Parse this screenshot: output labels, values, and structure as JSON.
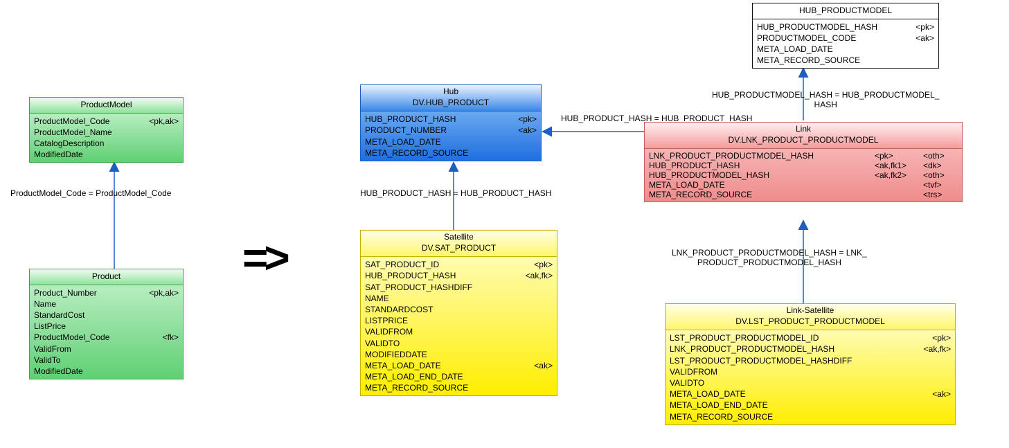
{
  "arrow": "=>",
  "rel": {
    "pm_prod": "ProductModel_Code = ProductModel_Code",
    "hub_sat": "HUB_PRODUCT_HASH = HUB_PRODUCT_HASH",
    "hub_link": "HUB_PRODUCT_HASH = HUB_PRODUCT_HASH",
    "hubpm_link_l1": "HUB_PRODUCTMODEL_HASH = HUB_PRODUCTMODEL_",
    "hubpm_link_l2": "HASH",
    "link_lst_l1": "LNK_PRODUCT_PRODUCTMODEL_HASH = LNK_",
    "link_lst_l2": "PRODUCT_PRODUCTMODEL_HASH"
  },
  "entities": {
    "productmodel": {
      "title": "ProductModel",
      "rows": [
        {
          "name": "ProductModel_Code",
          "key": "<pk,ak>"
        },
        {
          "name": "ProductModel_Name",
          "key": ""
        },
        {
          "name": "CatalogDescription",
          "key": ""
        },
        {
          "name": "ModifiedDate",
          "key": ""
        }
      ]
    },
    "product": {
      "title": "Product",
      "rows": [
        {
          "name": "Product_Number",
          "key": "<pk,ak>"
        },
        {
          "name": "Name",
          "key": ""
        },
        {
          "name": "StandardCost",
          "key": ""
        },
        {
          "name": "ListPrice",
          "key": ""
        },
        {
          "name": "ProductModel_Code",
          "key": "<fk>"
        },
        {
          "name": "ValidFrom",
          "key": ""
        },
        {
          "name": "ValidTo",
          "key": ""
        },
        {
          "name": "ModifiedDate",
          "key": ""
        }
      ]
    },
    "hubproduct": {
      "stereo": "Hub",
      "title": "DV.HUB_PRODUCT",
      "rows": [
        {
          "name": "HUB_PRODUCT_HASH",
          "key": "<pk>"
        },
        {
          "name": "PRODUCT_NUMBER",
          "key": "<ak>"
        },
        {
          "name": "META_LOAD_DATE",
          "key": ""
        },
        {
          "name": "META_RECORD_SOURCE",
          "key": ""
        }
      ]
    },
    "satproduct": {
      "stereo": "Satellite",
      "title": "DV.SAT_PRODUCT",
      "rows": [
        {
          "name": "SAT_PRODUCT_ID",
          "key": "<pk>"
        },
        {
          "name": "HUB_PRODUCT_HASH",
          "key": "<ak,fk>"
        },
        {
          "name": "SAT_PRODUCT_HASHDIFF",
          "key": ""
        },
        {
          "name": "NAME",
          "key": ""
        },
        {
          "name": "STANDARDCOST",
          "key": ""
        },
        {
          "name": "LISTPRICE",
          "key": ""
        },
        {
          "name": "VALIDFROM",
          "key": ""
        },
        {
          "name": "VALIDTO",
          "key": ""
        },
        {
          "name": "MODIFIEDDATE",
          "key": ""
        },
        {
          "name": "META_LOAD_DATE",
          "key": "<ak>"
        },
        {
          "name": "META_LOAD_END_DATE",
          "key": ""
        },
        {
          "name": "META_RECORD_SOURCE",
          "key": ""
        }
      ]
    },
    "hubproductmodel": {
      "title": "HUB_PRODUCTMODEL",
      "rows": [
        {
          "name": "HUB_PRODUCTMODEL_HASH",
          "key": "<pk>"
        },
        {
          "name": "PRODUCTMODEL_CODE",
          "key": "<ak>"
        },
        {
          "name": "META_LOAD_DATE",
          "key": ""
        },
        {
          "name": "META_RECORD_SOURCE",
          "key": ""
        }
      ]
    },
    "link": {
      "stereo": "Link",
      "title": "DV.LNK_PRODUCT_PRODUCTMODEL",
      "rows": [
        {
          "name": "LNK_PRODUCT_PRODUCTMODEL_HASH",
          "k1": "<pk>",
          "k2": "<oth>"
        },
        {
          "name": "HUB_PRODUCT_HASH",
          "k1": "<ak,fk1>",
          "k2": "<dk>"
        },
        {
          "name": "HUB_PRODUCTMODEL_HASH",
          "k1": "<ak,fk2>",
          "k2": "<oth>"
        },
        {
          "name": "META_LOAD_DATE",
          "k1": "",
          "k2": "<tvf>"
        },
        {
          "name": "META_RECORD_SOURCE",
          "k1": "",
          "k2": "<trs>"
        }
      ]
    },
    "linksat": {
      "stereo": "Link-Satellite",
      "title": "DV.LST_PRODUCT_PRODUCTMODEL",
      "rows": [
        {
          "name": "LST_PRODUCT_PRODUCTMODEL_ID",
          "key": "<pk>"
        },
        {
          "name": "LNK_PRODUCT_PRODUCTMODEL_HASH",
          "key": "<ak,fk>"
        },
        {
          "name": "LST_PRODUCT_PRODUCTMODEL_HASHDIFF",
          "key": ""
        },
        {
          "name": "VALIDFROM",
          "key": ""
        },
        {
          "name": "VALIDTO",
          "key": ""
        },
        {
          "name": "META_LOAD_DATE",
          "key": "<ak>"
        },
        {
          "name": "META_LOAD_END_DATE",
          "key": ""
        },
        {
          "name": "META_RECORD_SOURCE",
          "key": ""
        }
      ]
    }
  }
}
